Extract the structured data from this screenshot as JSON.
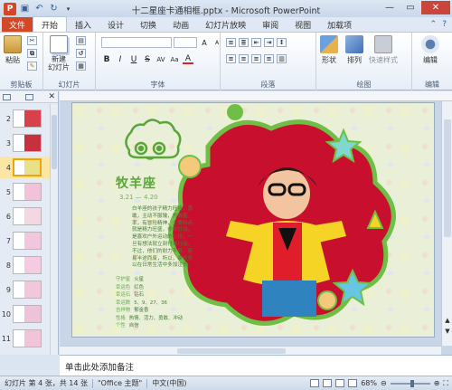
{
  "window": {
    "title": "十二星座卡通相框.pptx - Microsoft PowerPoint"
  },
  "tabs": [
    "文件",
    "开始",
    "插入",
    "设计",
    "切换",
    "动画",
    "幻灯片放映",
    "审阅",
    "视图",
    "加载项"
  ],
  "ribbon": {
    "groups": {
      "clipboard": "剪贴板",
      "slides": "幻灯片",
      "font": "字体",
      "paragraph": "段落",
      "drawing": "绘图",
      "editing": "编辑"
    },
    "buttons": {
      "paste": "粘贴",
      "new_slide": "新建\n幻灯片",
      "shapes": "形状",
      "arrange": "排列",
      "quick_styles": "快速样式",
      "editing": "编辑"
    }
  },
  "thumbnails": [
    {
      "num": "2",
      "color": "#d8404a"
    },
    {
      "num": "3",
      "color": "#c6313d"
    },
    {
      "num": "4",
      "color": "#e8e18a"
    },
    {
      "num": "5",
      "color": "#f1c2d8"
    },
    {
      "num": "6",
      "color": "#f3d8e4"
    },
    {
      "num": "7",
      "color": "#f0c7dc"
    },
    {
      "num": "8",
      "color": "#f4cbe0"
    },
    {
      "num": "9",
      "color": "#f2c6db"
    },
    {
      "num": "10",
      "color": "#eec2d8"
    },
    {
      "num": "11",
      "color": "#f1c4da"
    }
  ],
  "selected_slide": "4",
  "slide": {
    "zodiac_name": "牧羊座",
    "dates": "3.21 — 4.20",
    "description": "白羊座的孩子精力旺盛，勇敢，主动不服输，热情直率，有冒险精神，主要特点就是精力旺盛，非常好动，是喜欢户外运动的小孩，一旦有想法就立刻付诸行动，不过，他们的耐力不够，容易半途而废，所以，家长可以在日常生活中多加注意。",
    "info": [
      {
        "label": "守护星",
        "value": "火星"
      },
      {
        "label": "幸运色",
        "value": "红色"
      },
      {
        "label": "幸运石",
        "value": "钻石"
      },
      {
        "label": "幸运数",
        "value": "5、9、27、36"
      },
      {
        "label": "吉祥物",
        "value": "郁金香"
      },
      {
        "label": "性格",
        "value": "热情、活力、勇敢、冲动"
      },
      {
        "label": "个性",
        "value": "自信"
      }
    ]
  },
  "notes_placeholder": "单击此处添加备注",
  "status": {
    "slide_info": "幻灯片 第 4 张，共 14 张",
    "theme": "\"Office 主题\"",
    "language": "中文(中国)",
    "zoom": "68%"
  },
  "colors": {
    "ribbon_active_tab": "#d24726",
    "slide_bg": "#e8efd6",
    "zodiac_green": "#5aa63b",
    "frame_red": "#c8102e"
  }
}
